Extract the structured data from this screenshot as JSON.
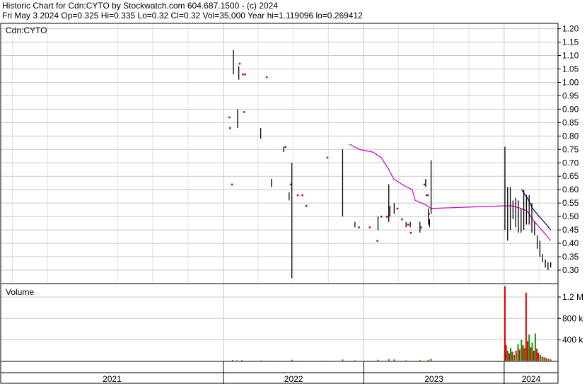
{
  "header": {
    "line1": "Historic Chart for Cdn:CYTO by Stockwatch.com 604.687.1500 - (c) 2024",
    "line2": "Fri May  3 2024  Op=0.325  Hi=0.335  Lo=0.32  Cl=0.32  Vol=35,000  Year hi=1.119096  lo=0.269412"
  },
  "price_panel": {
    "symbol_label": "Cdn:CYTO"
  },
  "volume_panel": {
    "label": "Volume"
  },
  "colors": {
    "price_bar": "#000000",
    "price_dot": "#cc0000",
    "moving_avg": "#cc00cc",
    "moving_avg_short": "#000080",
    "vol_up": "#009900",
    "vol_down": "#dd0000",
    "grid": "#c8c8c8"
  },
  "chart_data": [
    {
      "type": "line",
      "title": "",
      "ylim": [
        0.25,
        1.22
      ],
      "yticks": [
        0.3,
        0.35,
        0.4,
        0.45,
        0.5,
        0.55,
        0.6,
        0.65,
        0.7,
        0.75,
        0.8,
        0.85,
        0.9,
        0.95,
        1.0,
        1.05,
        1.1,
        1.15,
        1.2
      ],
      "ytick_labels": [
        "0.30",
        "0.35",
        "0.40",
        "0.45",
        "0.50",
        "0.55",
        "0.60",
        "0.65",
        "0.70",
        "0.75",
        "0.80",
        "0.85",
        "0.90",
        "0.95",
        "1.00",
        "1.05",
        "1.10",
        "1.15",
        "1.20"
      ],
      "x_labels": [
        "2021",
        "2022",
        "2023",
        "2024"
      ],
      "grid": true,
      "series": [
        {
          "role": "price_range",
          "values": [
            {
              "x": "2022-01-27",
              "low": 1.03,
              "high": 1.12
            },
            {
              "x": "2022-02-10",
              "low": 1.01,
              "high": 1.06
            },
            {
              "x": "2022-02-07",
              "low": 0.83,
              "high": 0.9
            },
            {
              "x": "2022-04-08",
              "low": 0.79,
              "high": 0.83
            },
            {
              "x": "2022-05-06",
              "low": 0.61,
              "high": 0.64
            },
            {
              "x": "2022-06-07",
              "low": 0.74,
              "high": 0.76
            },
            {
              "x": "2022-06-21",
              "low": 0.56,
              "high": 0.59
            },
            {
              "x": "2022-06-28",
              "low": 0.27,
              "high": 0.7
            },
            {
              "x": "2022-11-07",
              "low": 0.5,
              "high": 0.75
            },
            {
              "x": "2022-12-09",
              "low": 0.46,
              "high": 0.48
            },
            {
              "x": "2023-02-07",
              "low": 0.45,
              "high": 0.5
            },
            {
              "x": "2023-03-07",
              "low": 0.48,
              "high": 0.62
            },
            {
              "x": "2023-03-10",
              "low": 0.5,
              "high": 0.54
            },
            {
              "x": "2023-03-21",
              "low": 0.51,
              "high": 0.55
            },
            {
              "x": "2023-04-21",
              "low": 0.46,
              "high": 0.48
            },
            {
              "x": "2023-05-02",
              "low": 0.46,
              "high": 0.48
            },
            {
              "x": "2023-05-27",
              "low": 0.44,
              "high": 0.48
            },
            {
              "x": "2023-06-11",
              "low": 0.61,
              "high": 0.64
            },
            {
              "x": "2023-06-18",
              "low": 0.47,
              "high": 0.53
            },
            {
              "x": "2023-06-21",
              "low": 0.46,
              "high": 0.49
            },
            {
              "x": "2023-06-25",
              "low": 0.51,
              "high": 0.71
            },
            {
              "x": "2024-01-03",
              "low": 0.45,
              "high": 0.76
            },
            {
              "x": "2024-01-10",
              "low": 0.41,
              "high": 0.61
            },
            {
              "x": "2024-01-17",
              "low": 0.45,
              "high": 0.61
            },
            {
              "x": "2024-01-24",
              "low": 0.49,
              "high": 0.56
            },
            {
              "x": "2024-01-31",
              "low": 0.46,
              "high": 0.57
            },
            {
              "x": "2024-02-07",
              "low": 0.44,
              "high": 0.56
            },
            {
              "x": "2024-02-14",
              "low": 0.44,
              "high": 0.53
            },
            {
              "x": "2024-02-21",
              "low": 0.45,
              "high": 0.6
            },
            {
              "x": "2024-02-28",
              "low": 0.47,
              "high": 0.58
            },
            {
              "x": "2024-03-06",
              "low": 0.47,
              "high": 0.58
            },
            {
              "x": "2024-03-13",
              "low": 0.44,
              "high": 0.55
            },
            {
              "x": "2024-03-20",
              "low": 0.43,
              "high": 0.48
            },
            {
              "x": "2024-03-27",
              "low": 0.38,
              "high": 0.43
            },
            {
              "x": "2024-04-03",
              "low": 0.35,
              "high": 0.41
            },
            {
              "x": "2024-04-10",
              "low": 0.33,
              "high": 0.36
            },
            {
              "x": "2024-04-17",
              "low": 0.31,
              "high": 0.34
            },
            {
              "x": "2024-04-24",
              "low": 0.3,
              "high": 0.33
            },
            {
              "x": "2024-05-01",
              "low": 0.31,
              "high": 0.33
            }
          ]
        },
        {
          "role": "price_points",
          "values": [
            {
              "x": "2022-01-16",
              "y": 0.87
            },
            {
              "x": "2022-01-18",
              "y": 0.83
            },
            {
              "x": "2022-01-23",
              "y": 0.62
            },
            {
              "x": "2022-02-12",
              "y": 1.07
            },
            {
              "x": "2022-02-20",
              "y": 1.03
            },
            {
              "x": "2022-02-26",
              "y": 1.03
            },
            {
              "x": "2022-02-24",
              "y": 0.89
            },
            {
              "x": "2022-04-23",
              "y": 1.02
            },
            {
              "x": "2022-06-11",
              "y": 0.76
            },
            {
              "x": "2022-06-25",
              "y": 0.62
            },
            {
              "x": "2022-07-13",
              "y": 0.58
            },
            {
              "x": "2022-07-25",
              "y": 0.58
            },
            {
              "x": "2022-08-04",
              "y": 0.54
            },
            {
              "x": "2022-09-28",
              "y": 0.72
            },
            {
              "x": "2022-12-19",
              "y": 0.46
            },
            {
              "x": "2023-01-16",
              "y": 0.46
            },
            {
              "x": "2023-02-05",
              "y": 0.41
            },
            {
              "x": "2023-02-15",
              "y": 0.5
            },
            {
              "x": "2023-03-02",
              "y": 0.5
            },
            {
              "x": "2023-03-29",
              "y": 0.53
            },
            {
              "x": "2023-04-10",
              "y": 0.49
            },
            {
              "x": "2023-04-26",
              "y": 0.47
            },
            {
              "x": "2023-05-03",
              "y": 0.44
            },
            {
              "x": "2023-05-30",
              "y": 0.46
            },
            {
              "x": "2023-06-07",
              "y": 0.62
            },
            {
              "x": "2023-06-13",
              "y": 0.58
            },
            {
              "x": "2023-06-16",
              "y": 0.58
            },
            {
              "x": "2023-06-19",
              "y": 0.51
            }
          ]
        },
        {
          "role": "moving_average",
          "values": [
            {
              "x": "2022-11-25",
              "y": 0.77
            },
            {
              "x": "2022-12-20",
              "y": 0.75
            },
            {
              "x": "2023-01-25",
              "y": 0.74
            },
            {
              "x": "2023-02-15",
              "y": 0.72
            },
            {
              "x": "2023-03-05",
              "y": 0.68
            },
            {
              "x": "2023-03-20",
              "y": 0.64
            },
            {
              "x": "2023-04-10",
              "y": 0.62
            },
            {
              "x": "2023-05-07",
              "y": 0.6
            },
            {
              "x": "2023-05-15",
              "y": 0.56
            },
            {
              "x": "2023-06-01",
              "y": 0.55
            },
            {
              "x": "2023-06-15",
              "y": 0.54
            },
            {
              "x": "2023-06-25",
              "y": 0.53
            },
            {
              "x": "2024-01-01",
              "y": 0.54
            },
            {
              "x": "2024-01-20",
              "y": 0.54
            },
            {
              "x": "2024-02-15",
              "y": 0.53
            },
            {
              "x": "2024-03-01",
              "y": 0.52
            },
            {
              "x": "2024-03-15",
              "y": 0.49
            },
            {
              "x": "2024-04-01",
              "y": 0.46
            },
            {
              "x": "2024-04-20",
              "y": 0.43
            },
            {
              "x": "2024-05-01",
              "y": 0.41
            }
          ]
        },
        {
          "role": "moving_average_short",
          "values": [
            {
              "x": "2024-02-15",
              "y": 0.6
            },
            {
              "x": "2024-03-01",
              "y": 0.57
            },
            {
              "x": "2024-03-15",
              "y": 0.53
            },
            {
              "x": "2024-04-01",
              "y": 0.5
            },
            {
              "x": "2024-04-20",
              "y": 0.47
            },
            {
              "x": "2024-05-01",
              "y": 0.45
            }
          ]
        }
      ]
    },
    {
      "type": "bar",
      "title": "",
      "ylim": [
        0,
        1450000
      ],
      "yticks": [
        400000,
        800000,
        1200000
      ],
      "ytick_labels": [
        "400 k",
        "800 k",
        "1.2 M"
      ],
      "series": [
        {
          "values": [
            {
              "x": "2022-01-25",
              "v": 25000,
              "dir": "down"
            },
            {
              "x": "2022-02-05",
              "v": 20000,
              "dir": "up"
            },
            {
              "x": "2022-02-18",
              "v": 22000,
              "dir": "down"
            },
            {
              "x": "2022-04-10",
              "v": 18000,
              "dir": "down"
            },
            {
              "x": "2022-05-08",
              "v": 15000,
              "dir": "up"
            },
            {
              "x": "2022-06-28",
              "v": 30000,
              "dir": "down"
            },
            {
              "x": "2022-07-20",
              "v": 15000,
              "dir": "up"
            },
            {
              "x": "2022-09-28",
              "v": 12000,
              "dir": "down"
            },
            {
              "x": "2022-11-07",
              "v": 35000,
              "dir": "up"
            },
            {
              "x": "2022-12-09",
              "v": 20000,
              "dir": "down"
            },
            {
              "x": "2023-02-07",
              "v": 30000,
              "dir": "down"
            },
            {
              "x": "2023-03-07",
              "v": 40000,
              "dir": "up"
            },
            {
              "x": "2023-03-21",
              "v": 35000,
              "dir": "down"
            },
            {
              "x": "2023-04-21",
              "v": 20000,
              "dir": "down"
            },
            {
              "x": "2023-05-27",
              "v": 25000,
              "dir": "up"
            },
            {
              "x": "2023-06-18",
              "v": 30000,
              "dir": "down"
            },
            {
              "x": "2023-06-25",
              "v": 45000,
              "dir": "up"
            },
            {
              "x": "2024-01-03",
              "v": 1400000,
              "dir": "down"
            },
            {
              "x": "2024-01-06",
              "v": 300000,
              "dir": "down"
            },
            {
              "x": "2024-01-10",
              "v": 200000,
              "dir": "up"
            },
            {
              "x": "2024-01-14",
              "v": 150000,
              "dir": "down"
            },
            {
              "x": "2024-01-18",
              "v": 250000,
              "dir": "up"
            },
            {
              "x": "2024-01-22",
              "v": 180000,
              "dir": "down"
            },
            {
              "x": "2024-01-27",
              "v": 120000,
              "dir": "up"
            },
            {
              "x": "2024-02-01",
              "v": 200000,
              "dir": "down"
            },
            {
              "x": "2024-02-06",
              "v": 320000,
              "dir": "up"
            },
            {
              "x": "2024-02-10",
              "v": 220000,
              "dir": "down"
            },
            {
              "x": "2024-02-15",
              "v": 400000,
              "dir": "up"
            },
            {
              "x": "2024-02-19",
              "v": 300000,
              "dir": "down"
            },
            {
              "x": "2024-02-23",
              "v": 250000,
              "dir": "up"
            },
            {
              "x": "2024-02-27",
              "v": 1280000,
              "dir": "down"
            },
            {
              "x": "2024-03-02",
              "v": 380000,
              "dir": "down"
            },
            {
              "x": "2024-03-06",
              "v": 500000,
              "dir": "up"
            },
            {
              "x": "2024-03-10",
              "v": 260000,
              "dir": "down"
            },
            {
              "x": "2024-03-14",
              "v": 350000,
              "dir": "up"
            },
            {
              "x": "2024-03-18",
              "v": 200000,
              "dir": "down"
            },
            {
              "x": "2024-03-22",
              "v": 520000,
              "dir": "up"
            },
            {
              "x": "2024-03-26",
              "v": 240000,
              "dir": "down"
            },
            {
              "x": "2024-03-30",
              "v": 160000,
              "dir": "down"
            },
            {
              "x": "2024-04-04",
              "v": 120000,
              "dir": "up"
            },
            {
              "x": "2024-04-09",
              "v": 90000,
              "dir": "down"
            },
            {
              "x": "2024-04-14",
              "v": 80000,
              "dir": "up"
            },
            {
              "x": "2024-04-19",
              "v": 60000,
              "dir": "down"
            },
            {
              "x": "2024-04-25",
              "v": 50000,
              "dir": "down"
            },
            {
              "x": "2024-05-01",
              "v": 35000,
              "dir": "down"
            }
          ]
        }
      ]
    }
  ]
}
